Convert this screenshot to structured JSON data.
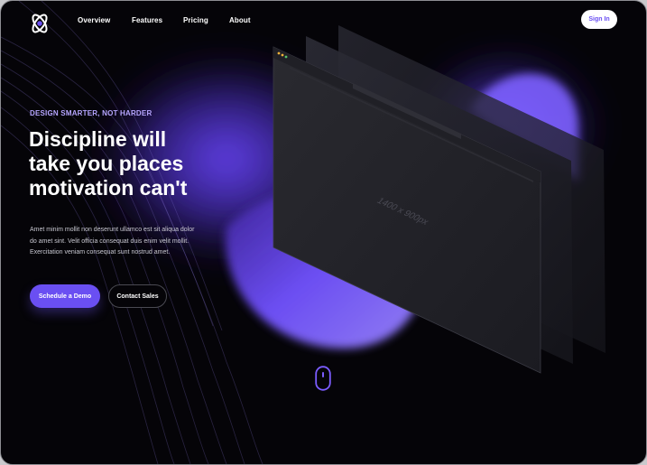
{
  "brand": {
    "logo_icon": "atom-icon",
    "accent_color": "#6a4ff2"
  },
  "nav": {
    "items": [
      {
        "label": "Overview"
      },
      {
        "label": "Features"
      },
      {
        "label": "Pricing"
      },
      {
        "label": "About"
      }
    ],
    "signin_label": "Sign In"
  },
  "hero": {
    "eyebrow": "DESIGN SMARTER, NOT HARDER",
    "headline_lines": [
      "Discipline will",
      "take you places",
      "motivation can't"
    ],
    "body_lines": [
      "Amet minim mollit non deserunt ullamco est sit aliqua dolor",
      "do amet sint. Velit officia consequat duis enim velit mollit.",
      "Exercitation veniam consequat sunt nostrud amet."
    ],
    "primary_cta": "Schedule a Demo",
    "secondary_cta": "Contact Sales"
  },
  "mockup": {
    "placeholder_label": "1400 x 900px"
  },
  "scroll_icon": "mouse-scroll-icon"
}
